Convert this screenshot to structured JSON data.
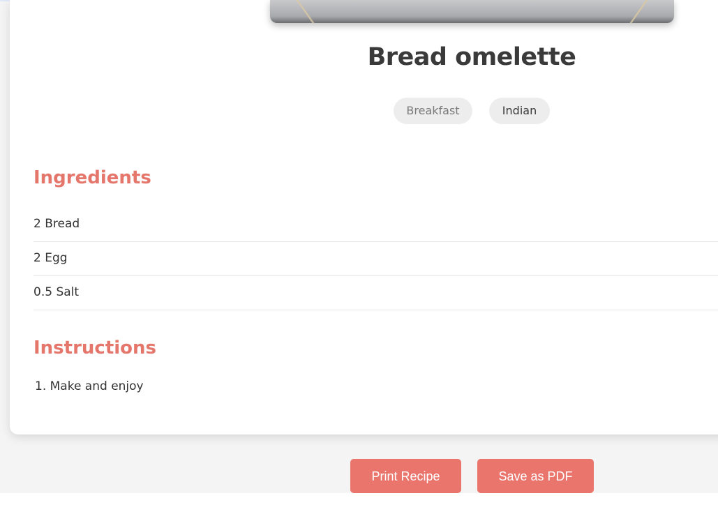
{
  "recipe": {
    "title": "Bread omelette",
    "tags": [
      "Breakfast",
      "Indian"
    ]
  },
  "ingredients": {
    "heading": "Ingredients",
    "items": [
      "2 Bread",
      "2 Egg",
      "0.5 Salt"
    ]
  },
  "instructions": {
    "heading": "Instructions",
    "steps": [
      "1. Make and enjoy"
    ]
  },
  "actions": {
    "print_label": "Print Recipe",
    "pdf_label": "Save as PDF"
  },
  "colors": {
    "accent": "#e9756c",
    "heading": "#e5766b",
    "title": "#3a3a3a"
  },
  "icons": {
    "cursor": "mouse-pointer-icon"
  }
}
